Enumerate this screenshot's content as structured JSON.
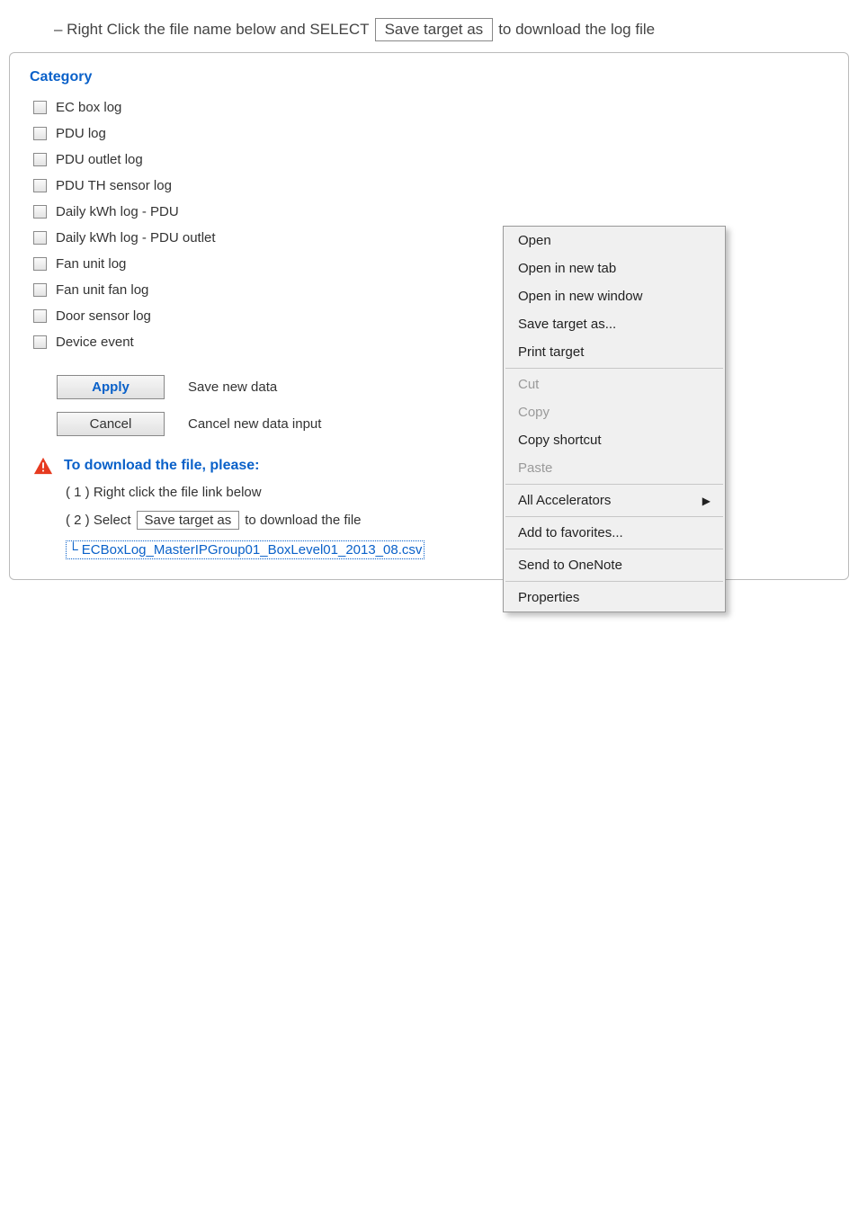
{
  "instruction": {
    "prefix": "– Right Click the file name below and SELECT",
    "boxed": "Save target as",
    "suffix": "to download the log file"
  },
  "panel": {
    "category_heading": "Category",
    "categories": [
      "EC box log",
      "PDU log",
      "PDU outlet log",
      "PDU TH sensor log",
      "Daily kWh log - PDU",
      "Daily kWh log - PDU outlet",
      "Fan unit log",
      "Fan unit fan log",
      "Door sensor log",
      "Device event"
    ],
    "buttons": {
      "apply": "Apply",
      "apply_desc": "Save new data",
      "cancel": "Cancel",
      "cancel_desc": "Cancel new data input"
    },
    "download": {
      "heading": "To download the file, please:",
      "step1": "( 1 ) Right click the file link below",
      "step2_prefix": "( 2 ) Select",
      "step2_box": "Save target as",
      "step2_suffix": "to download the file",
      "file_link": "ECBoxLog_MasterIPGroup01_BoxLevel01_2013_08.csv"
    }
  },
  "context_menu": {
    "groups": [
      [
        {
          "label": "Open",
          "enabled": true
        },
        {
          "label": "Open in new tab",
          "enabled": true
        },
        {
          "label": "Open in new window",
          "enabled": true
        },
        {
          "label": "Save target as...",
          "enabled": true
        },
        {
          "label": "Print target",
          "enabled": true
        }
      ],
      [
        {
          "label": "Cut",
          "enabled": false
        },
        {
          "label": "Copy",
          "enabled": false
        },
        {
          "label": "Copy shortcut",
          "enabled": true
        },
        {
          "label": "Paste",
          "enabled": false
        }
      ],
      [
        {
          "label": "All Accelerators",
          "enabled": true,
          "submenu": true
        }
      ],
      [
        {
          "label": "Add to favorites...",
          "enabled": true
        }
      ],
      [
        {
          "label": "Send to OneNote",
          "enabled": true
        }
      ],
      [
        {
          "label": "Properties",
          "enabled": true
        }
      ]
    ]
  }
}
